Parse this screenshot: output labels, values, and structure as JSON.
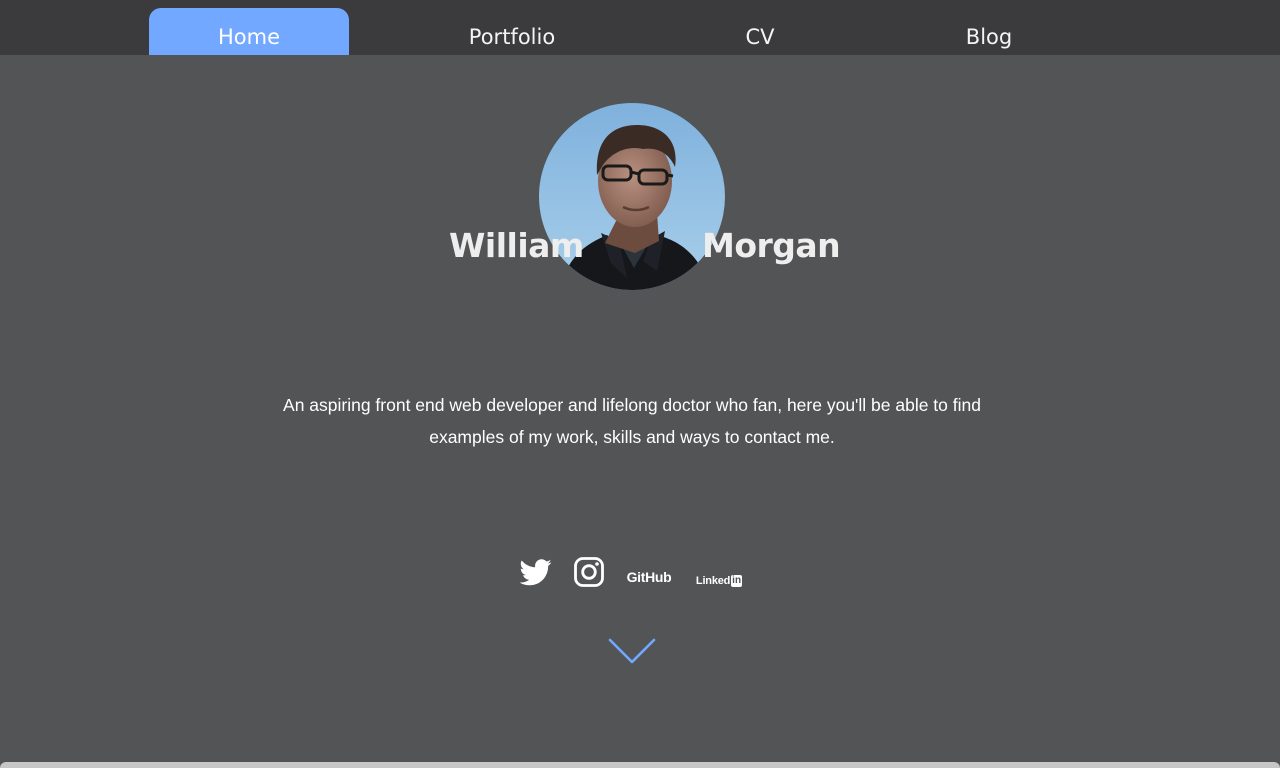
{
  "nav": {
    "tabs": [
      {
        "label": "Home",
        "active": true
      },
      {
        "label": "Portfolio",
        "active": false
      },
      {
        "label": "CV",
        "active": false
      },
      {
        "label": "Blog",
        "active": false
      }
    ]
  },
  "hero": {
    "first_name": "William",
    "last_name": "Morgan",
    "bio": "An aspiring front end web developer and lifelong doctor who fan, here you'll be able to find examples of my work, skills and ways to contact me."
  },
  "social": {
    "twitter_icon": "twitter-bird-icon",
    "instagram_icon": "instagram-camera-icon",
    "github_label": "GitHub",
    "linkedin_label": "Linked",
    "linkedin_in": "in"
  },
  "scroll": {
    "icon": "chevron-down-icon"
  },
  "colors": {
    "background": "#535456",
    "topbar": "#3b3b3d",
    "accent": "#72a8ff"
  }
}
